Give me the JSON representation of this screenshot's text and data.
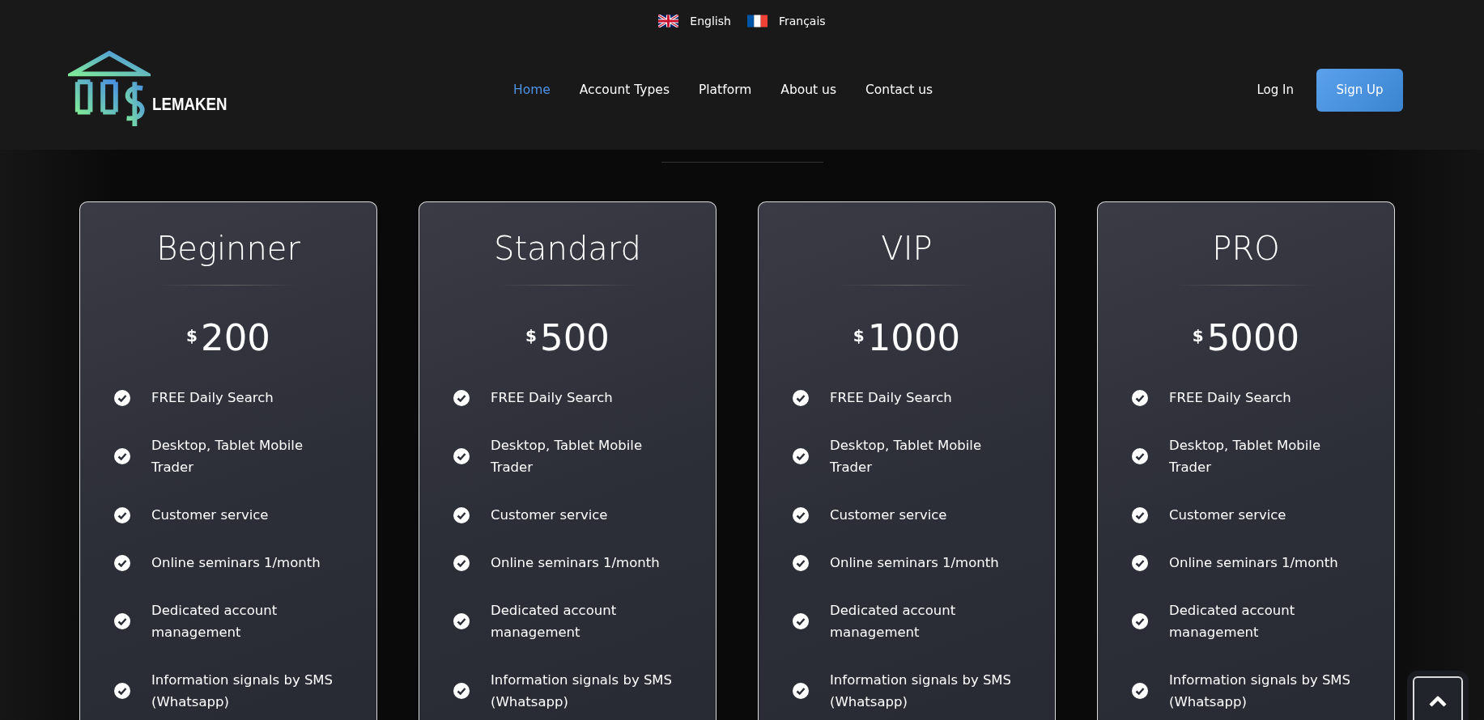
{
  "languages": [
    {
      "label": "English",
      "kind": "uk"
    },
    {
      "label": "Français",
      "kind": "fr"
    }
  ],
  "logo": {
    "text": "LEMAKEN"
  },
  "nav": [
    {
      "label": "Home",
      "selected": true
    },
    {
      "label": "Account Types",
      "selected": false
    },
    {
      "label": "Platform",
      "selected": false
    },
    {
      "label": "About us",
      "selected": false
    },
    {
      "label": "Contact us",
      "selected": false
    }
  ],
  "auth": {
    "login": "Log In",
    "signup": "Sign Up"
  },
  "plans": [
    {
      "name": "Beginner",
      "currency": "$",
      "price": "200",
      "features": [
        "FREE Daily Search",
        "Desktop, Tablet Mobile Trader",
        "Customer service",
        "Online seminars 1/month",
        "Dedicated account management",
        "Information signals by SMS (Whatsapp)"
      ]
    },
    {
      "name": "Standard",
      "currency": "$",
      "price": "500",
      "features": [
        "FREE Daily Search",
        "Desktop, Tablet Mobile Trader",
        "Customer service",
        "Online seminars 1/month",
        "Dedicated account management",
        "Information signals by SMS (Whatsapp)"
      ]
    },
    {
      "name": "VIP",
      "currency": "$",
      "price": "1000",
      "features": [
        "FREE Daily Search",
        "Desktop, Tablet Mobile Trader",
        "Customer service",
        "Online seminars 1/month",
        "Dedicated account management",
        "Information signals by SMS (Whatsapp)"
      ]
    },
    {
      "name": "PRO",
      "currency": "$",
      "price": "5000",
      "features": [
        "FREE Daily Search",
        "Desktop, Tablet Mobile Trader",
        "Customer service",
        "Online seminars 1/month",
        "Dedicated account management",
        "Information signals by SMS (Whatsapp)"
      ]
    }
  ]
}
